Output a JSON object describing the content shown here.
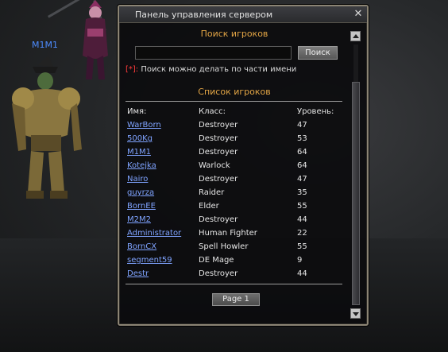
{
  "scene": {
    "nameplate": "M1M1"
  },
  "window": {
    "title": "Панель управления сервером",
    "search_section": "Поиск игроков",
    "search_placeholder": "",
    "search_button": "Поиск",
    "hint_mark": "[*]:",
    "hint_text": " Поиск можно делать по части имени",
    "list_section": "Список игроков",
    "columns": {
      "name": "Имя:",
      "class": "Класс:",
      "level": "Уровень:"
    },
    "players": [
      {
        "name": "WarBorn",
        "class": "Destroyer",
        "level": "47"
      },
      {
        "name": "500Kg",
        "class": "Destroyer",
        "level": "53"
      },
      {
        "name": "M1M1",
        "class": "Destroyer",
        "level": "64"
      },
      {
        "name": "Kotejka",
        "class": "Warlock",
        "level": "64"
      },
      {
        "name": "Nairo",
        "class": "Destroyer",
        "level": "47"
      },
      {
        "name": "guyrza",
        "class": "Raider",
        "level": "35"
      },
      {
        "name": "BornEE",
        "class": "Elder",
        "level": "55"
      },
      {
        "name": "M2M2",
        "class": "Destroyer",
        "level": "44"
      },
      {
        "name": "Administrator",
        "class": "Human Fighter",
        "level": "22"
      },
      {
        "name": "BornCX",
        "class": "Spell Howler",
        "level": "55"
      },
      {
        "name": "segment59",
        "class": "DE Mage",
        "level": "9"
      },
      {
        "name": "Destr",
        "class": "Destroyer",
        "level": "44"
      }
    ],
    "page_button": "Page 1"
  }
}
